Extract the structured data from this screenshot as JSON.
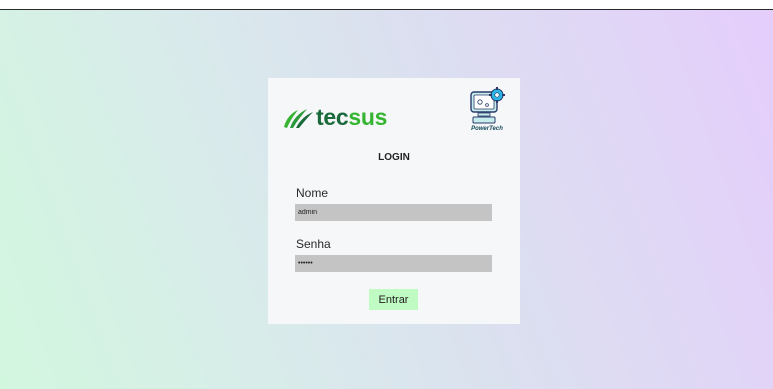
{
  "brand": {
    "part1": "tec",
    "part2": "sus",
    "colors": {
      "dark": "#1a6a3c",
      "light": "#35b531"
    },
    "icon": "leaf-icon"
  },
  "partner": {
    "name": "PowerTech",
    "icon": "computer-gear-icon"
  },
  "login": {
    "title": "LOGIN",
    "name_label": "Nome",
    "name_value": "admin",
    "password_label": "Senha",
    "password_value": "123456",
    "submit_label": "Entrar"
  },
  "colors": {
    "card_bg": "#f5f7f9",
    "input_bg": "#c4c4c4",
    "button_bg": "#c0fbc3"
  }
}
